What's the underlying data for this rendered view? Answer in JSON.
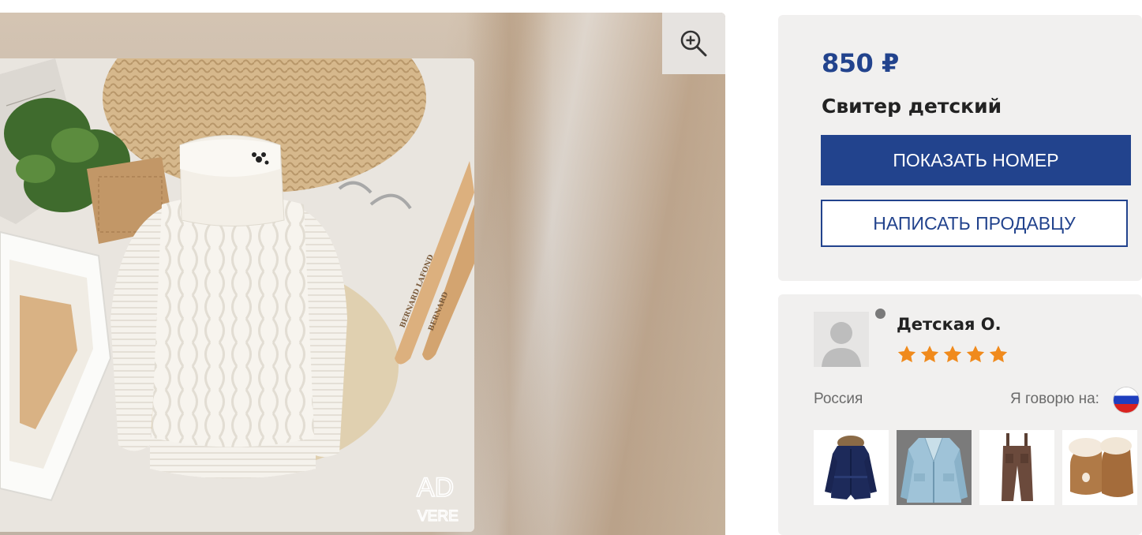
{
  "listing": {
    "price": "850 ₽",
    "title": "Свитер детский"
  },
  "buttons": {
    "show_number": "ПОКАЗАТЬ НОМЕР",
    "write_seller": "НАПИСАТЬ ПРОДАВЦУ"
  },
  "gallery": {
    "zoom_icon": "zoom-in-icon",
    "watermark_top": "AD",
    "watermark_bottom": "VERE"
  },
  "seller": {
    "name": "Детская О.",
    "rating": 5,
    "rating_max": 5,
    "status": "offline",
    "country": "Россия",
    "languages_label": "Я говорю на:",
    "language_flag": "russia-flag-icon",
    "other_items": [
      "winter-jacket-thumbnail",
      "light-blue-jacket-thumbnail",
      "brown-pants-thumbnail",
      "fur-boots-thumbnail"
    ]
  },
  "colors": {
    "brand_blue": "#22438d",
    "card_bg": "#f1f0ef",
    "star": "#f08a1c"
  }
}
